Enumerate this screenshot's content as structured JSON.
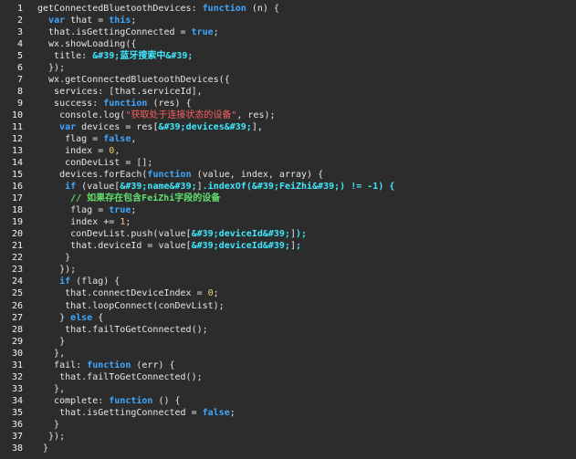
{
  "editor": {
    "lines": [
      {
        "num": "1",
        "tokens": [
          {
            "t": "pl",
            "v": "getConnectedBluetoothDevices: "
          },
          {
            "t": "kw",
            "v": "function"
          },
          {
            "t": "pl",
            "v": " (n) {"
          }
        ]
      },
      {
        "num": "2",
        "tokens": [
          {
            "t": "pl",
            "v": "  "
          },
          {
            "t": "kw",
            "v": "var"
          },
          {
            "t": "pl",
            "v": " that = "
          },
          {
            "t": "kw",
            "v": "this"
          },
          {
            "t": "pl",
            "v": ";"
          }
        ]
      },
      {
        "num": "3",
        "tokens": [
          {
            "t": "pl",
            "v": "  that.isGettingConnected = "
          },
          {
            "t": "kw",
            "v": "true"
          },
          {
            "t": "pl",
            "v": ";"
          }
        ]
      },
      {
        "num": "4",
        "tokens": [
          {
            "t": "pl",
            "v": "  wx.showLoading({"
          }
        ]
      },
      {
        "num": "5",
        "tokens": [
          {
            "t": "pl",
            "v": "   title: "
          },
          {
            "t": "ent",
            "v": "&#39;蓝牙搜索中&#39;"
          },
          {
            "t": "pl",
            "v": ""
          }
        ]
      },
      {
        "num": "6",
        "tokens": [
          {
            "t": "pl",
            "v": "  });"
          }
        ]
      },
      {
        "num": "7",
        "tokens": [
          {
            "t": "pl",
            "v": "  wx.getConnectedBluetoothDevices({"
          }
        ]
      },
      {
        "num": "8",
        "tokens": [
          {
            "t": "pl",
            "v": "   services: [that.serviceId],"
          }
        ]
      },
      {
        "num": "9",
        "tokens": [
          {
            "t": "pl",
            "v": "   success: "
          },
          {
            "t": "kw",
            "v": "function"
          },
          {
            "t": "pl",
            "v": " (res) {"
          }
        ]
      },
      {
        "num": "10",
        "tokens": [
          {
            "t": "pl",
            "v": "    console.log("
          },
          {
            "t": "str",
            "v": "\"获取处于连接状态的设备\""
          },
          {
            "t": "pl",
            "v": ", res);"
          }
        ]
      },
      {
        "num": "11",
        "tokens": [
          {
            "t": "pl",
            "v": "    "
          },
          {
            "t": "kw",
            "v": "var"
          },
          {
            "t": "pl",
            "v": " devices = res["
          },
          {
            "t": "ent",
            "v": "&#39;devices&#39;"
          },
          {
            "t": "pl",
            "v": "],"
          }
        ]
      },
      {
        "num": "12",
        "tokens": [
          {
            "t": "pl",
            "v": "     flag = "
          },
          {
            "t": "kw",
            "v": "false"
          },
          {
            "t": "pl",
            "v": ","
          }
        ]
      },
      {
        "num": "13",
        "tokens": [
          {
            "t": "pl",
            "v": "     index = "
          },
          {
            "t": "cn",
            "v": "0"
          },
          {
            "t": "pl",
            "v": ","
          }
        ]
      },
      {
        "num": "14",
        "tokens": [
          {
            "t": "pl",
            "v": "     conDevList = [];"
          }
        ]
      },
      {
        "num": "15",
        "tokens": [
          {
            "t": "pl",
            "v": "    devices.forEach("
          },
          {
            "t": "kw",
            "v": "function"
          },
          {
            "t": "pl",
            "v": " (value, index, array) {"
          }
        ]
      },
      {
        "num": "16",
        "tokens": [
          {
            "t": "pl",
            "v": "     "
          },
          {
            "t": "kw",
            "v": "if"
          },
          {
            "t": "pl",
            "v": " (value["
          },
          {
            "t": "ent",
            "v": "&#39;name&#39;"
          },
          {
            "t": "pl",
            "v": "]"
          },
          {
            "t": "ent",
            "v": ".indexOf(&#39;FeiZhi&#39;) != -1) {"
          }
        ]
      },
      {
        "num": "17",
        "tokens": [
          {
            "t": "pl",
            "v": "      "
          },
          {
            "t": "cm",
            "v": "// 如果存在包含FeiZhi字段的设备"
          }
        ]
      },
      {
        "num": "18",
        "tokens": [
          {
            "t": "pl",
            "v": "      flag = "
          },
          {
            "t": "kw",
            "v": "true"
          },
          {
            "t": "pl",
            "v": ";"
          }
        ]
      },
      {
        "num": "19",
        "tokens": [
          {
            "t": "pl",
            "v": "      index += "
          },
          {
            "t": "cn",
            "v": "1"
          },
          {
            "t": "pl",
            "v": ";"
          }
        ]
      },
      {
        "num": "20",
        "tokens": [
          {
            "t": "pl",
            "v": "      conDevList.push(value["
          },
          {
            "t": "ent",
            "v": "&#39;deviceId&#39;"
          },
          {
            "t": "pl",
            "v": "]"
          },
          {
            "t": "ent",
            "v": ");"
          }
        ]
      },
      {
        "num": "21",
        "tokens": [
          {
            "t": "pl",
            "v": "      that.deviceId = value["
          },
          {
            "t": "ent",
            "v": "&#39;deviceId&#39;"
          },
          {
            "t": "pl",
            "v": "]"
          },
          {
            "t": "ent",
            "v": ";"
          }
        ]
      },
      {
        "num": "22",
        "tokens": [
          {
            "t": "pl",
            "v": "     }"
          }
        ]
      },
      {
        "num": "23",
        "tokens": [
          {
            "t": "pl",
            "v": "    });"
          }
        ]
      },
      {
        "num": "24",
        "tokens": [
          {
            "t": "pl",
            "v": "    "
          },
          {
            "t": "kw",
            "v": "if"
          },
          {
            "t": "pl",
            "v": " (flag) {"
          }
        ]
      },
      {
        "num": "25",
        "tokens": [
          {
            "t": "pl",
            "v": "     that.connectDeviceIndex = "
          },
          {
            "t": "cn",
            "v": "0"
          },
          {
            "t": "pl",
            "v": ";"
          }
        ]
      },
      {
        "num": "26",
        "tokens": [
          {
            "t": "pl",
            "v": "     that.loopConnect(conDevList);"
          }
        ]
      },
      {
        "num": "27",
        "tokens": [
          {
            "t": "pl",
            "v": "    } "
          },
          {
            "t": "kw",
            "v": "else"
          },
          {
            "t": "pl",
            "v": " {"
          }
        ]
      },
      {
        "num": "28",
        "tokens": [
          {
            "t": "pl",
            "v": "     that.failToGetConnected();"
          }
        ]
      },
      {
        "num": "29",
        "tokens": [
          {
            "t": "pl",
            "v": "    }"
          }
        ]
      },
      {
        "num": "30",
        "tokens": [
          {
            "t": "pl",
            "v": "   },"
          }
        ]
      },
      {
        "num": "31",
        "tokens": [
          {
            "t": "pl",
            "v": "   fail: "
          },
          {
            "t": "kw",
            "v": "function"
          },
          {
            "t": "pl",
            "v": " (err) {"
          }
        ]
      },
      {
        "num": "32",
        "tokens": [
          {
            "t": "pl",
            "v": "    that.failToGetConnected();"
          }
        ]
      },
      {
        "num": "33",
        "tokens": [
          {
            "t": "pl",
            "v": "   },"
          }
        ]
      },
      {
        "num": "34",
        "tokens": [
          {
            "t": "pl",
            "v": "   complete: "
          },
          {
            "t": "kw",
            "v": "function"
          },
          {
            "t": "pl",
            "v": " () {"
          }
        ]
      },
      {
        "num": "35",
        "tokens": [
          {
            "t": "pl",
            "v": "    that.isGettingConnected = "
          },
          {
            "t": "kw",
            "v": "false"
          },
          {
            "t": "pl",
            "v": ";"
          }
        ]
      },
      {
        "num": "36",
        "tokens": [
          {
            "t": "pl",
            "v": "   }"
          }
        ]
      },
      {
        "num": "37",
        "tokens": [
          {
            "t": "pl",
            "v": "  });"
          }
        ]
      },
      {
        "num": "38",
        "tokens": [
          {
            "t": "pl",
            "v": " }"
          }
        ]
      }
    ]
  },
  "colors": {
    "background": "#2c2c2c",
    "keyword": "#3ea7ff",
    "string": "#ff5f5f",
    "entity": "#3ee8ff",
    "comment": "#5fe06d",
    "number": "#f0d36a",
    "plain": "#e6e6e6"
  }
}
